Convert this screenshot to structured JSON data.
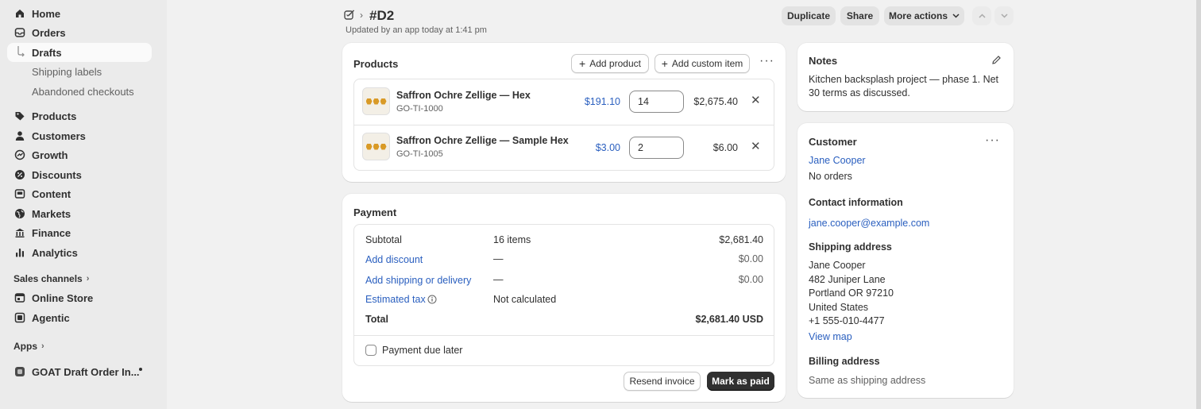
{
  "sidebar": {
    "items": [
      {
        "label": "Home",
        "icon": "home-icon"
      },
      {
        "label": "Orders",
        "icon": "orders-icon"
      },
      {
        "label": "Drafts"
      },
      {
        "label": "Shipping labels"
      },
      {
        "label": "Abandoned checkouts"
      },
      {
        "label": "Products",
        "icon": "tag-icon"
      },
      {
        "label": "Customers",
        "icon": "person-icon"
      },
      {
        "label": "Growth",
        "icon": "growth-icon"
      },
      {
        "label": "Discounts",
        "icon": "discount-icon"
      },
      {
        "label": "Content",
        "icon": "content-icon"
      },
      {
        "label": "Markets",
        "icon": "globe-icon"
      },
      {
        "label": "Finance",
        "icon": "bank-icon"
      },
      {
        "label": "Analytics",
        "icon": "bar-chart-icon"
      }
    ],
    "sales_channels_label": "Sales channels",
    "channels": [
      {
        "label": "Online Store",
        "icon": "store-icon"
      },
      {
        "label": "Agentic",
        "icon": "agentic-icon"
      }
    ],
    "apps_label": "Apps",
    "app_item": {
      "label": "GOAT Draft Order In..."
    }
  },
  "header": {
    "title": "#D2",
    "subtitle": "Updated by an app today at 1:41 pm",
    "duplicate": "Duplicate",
    "share": "Share",
    "more_actions": "More actions"
  },
  "products": {
    "title": "Products",
    "add_product": "Add product",
    "add_custom_item": "Add custom item",
    "rows": [
      {
        "name": "Saffron Ochre Zellige — Hex",
        "sku": "GO-TI-1000",
        "price": "$191.10",
        "qty": "14",
        "total": "$2,675.40"
      },
      {
        "name": "Saffron Ochre Zellige — Sample Hex",
        "sku": "GO-TI-1005",
        "price": "$3.00",
        "qty": "2",
        "total": "$6.00"
      }
    ]
  },
  "payment": {
    "title": "Payment",
    "subtotal_label": "Subtotal",
    "subtotal_items": "16 items",
    "subtotal_value": "$2,681.40",
    "discount_label": "Add discount",
    "discount_mid": "—",
    "discount_value": "$0.00",
    "shipping_label": "Add shipping or delivery",
    "shipping_mid": "—",
    "shipping_value": "$0.00",
    "tax_label": "Estimated tax",
    "tax_mid": "Not calculated",
    "total_label": "Total",
    "total_value": "$2,681.40 USD",
    "due_later": "Payment due later",
    "resend_invoice": "Resend invoice",
    "mark_as_paid": "Mark as paid"
  },
  "notes": {
    "title": "Notes",
    "line1": "Kitchen backsplash project — phase 1. Net",
    "line2": "30 terms as discussed."
  },
  "customer": {
    "title": "Customer",
    "name": "Jane Cooper",
    "orders": "No orders",
    "contact_title": "Contact information",
    "email": "jane.cooper@example.com",
    "shipping_title": "Shipping address",
    "address": [
      "Jane Cooper",
      "482 Juniper Lane",
      "Portland OR 97210",
      "United States",
      "+1 555-010-4477"
    ],
    "view_map": "View map",
    "billing_title": "Billing address",
    "billing_value": "Same as shipping address"
  },
  "colors": {
    "link": "#2a5fbf",
    "primary_button": "#303030",
    "accent_tile": "#d99a26"
  }
}
